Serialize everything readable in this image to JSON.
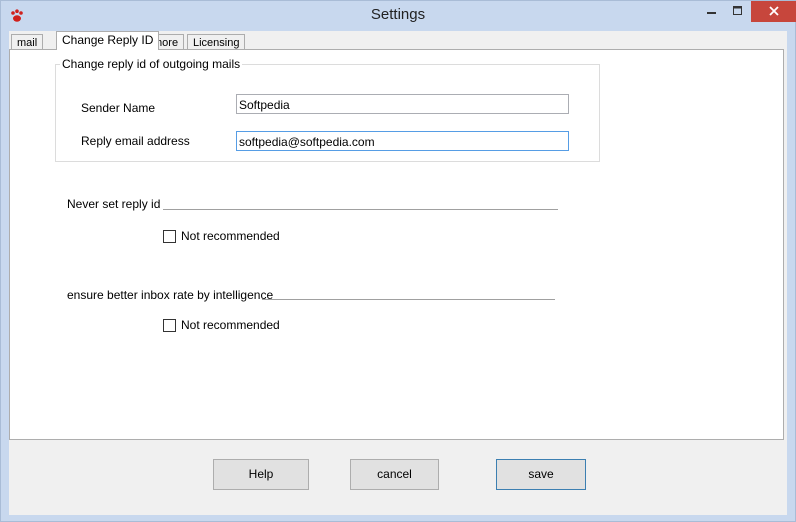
{
  "window": {
    "title": "Settings",
    "icon": "paw-icon",
    "controls": [
      "minimize-icon",
      "maximize-icon",
      "close-icon"
    ],
    "close_color": "#c7463c"
  },
  "tabs": [
    {
      "label": "mail",
      "active": false
    },
    {
      "label": "Change Reply ID",
      "active": true
    },
    {
      "label": "more",
      "active": false
    },
    {
      "label": "Licensing",
      "active": false
    }
  ],
  "reply_group": {
    "title": "Change reply id of outgoing mails",
    "sender_name_label": "Sender Name",
    "sender_name_value": "Softpedia",
    "reply_email_label": "Reply email address",
    "reply_email_value": "softpedia@softpedia.com"
  },
  "never_set": {
    "label": "Never set reply id",
    "checkbox_label": "Not recommended",
    "checked": false
  },
  "intelligence": {
    "label": "ensure better inbox rate by intelligence",
    "checkbox_label": "Not  recommended",
    "checked": false
  },
  "buttons": {
    "help": "Help",
    "cancel": "cancel",
    "save": "save"
  }
}
